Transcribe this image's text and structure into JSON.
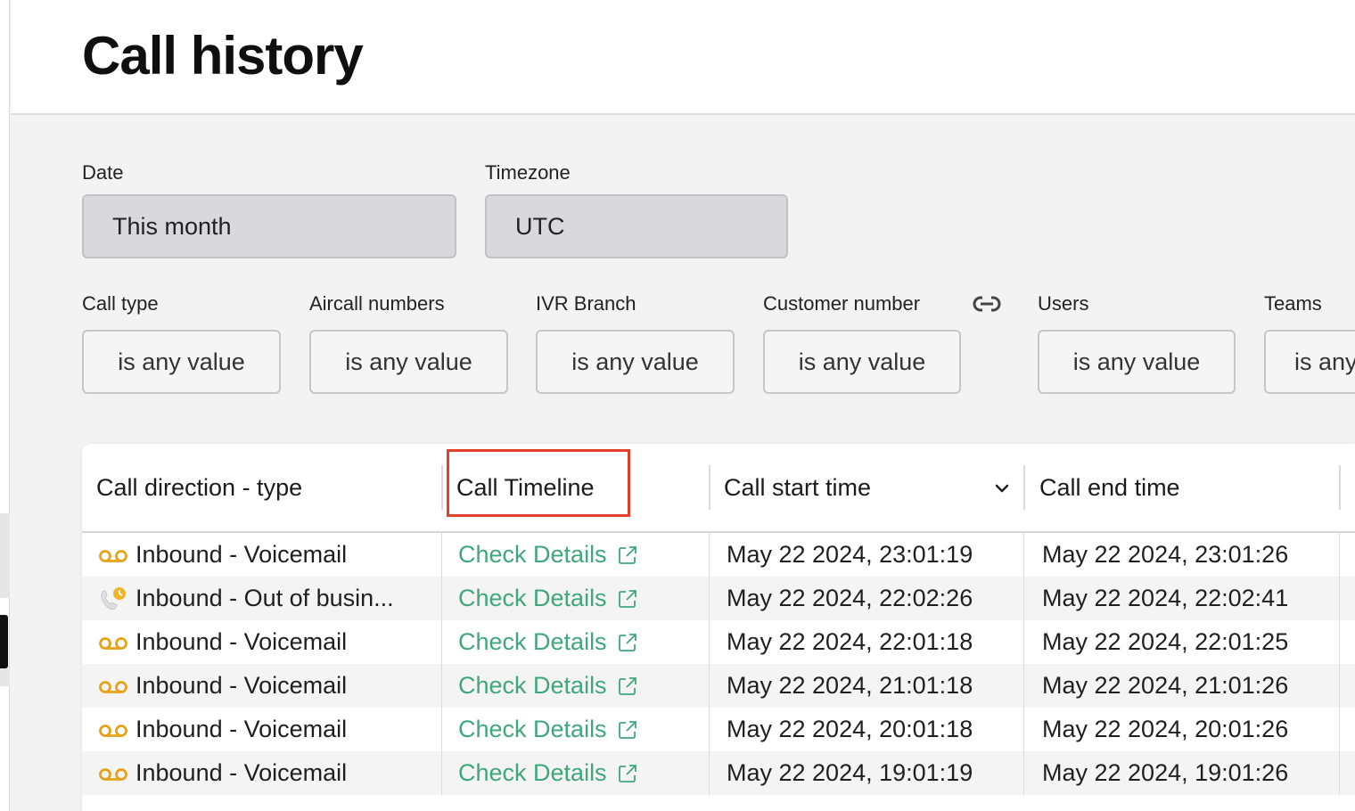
{
  "page": {
    "title": "Call history"
  },
  "filters": {
    "date": {
      "label": "Date",
      "value": "This month"
    },
    "timezone": {
      "label": "Timezone",
      "value": "UTC"
    },
    "items": [
      {
        "label": "Call type",
        "value": "is any value"
      },
      {
        "label": "Aircall numbers",
        "value": "is any value"
      },
      {
        "label": "IVR Branch",
        "value": "is any value"
      },
      {
        "label": "Customer number",
        "value": "is any value"
      },
      {
        "label": "Users",
        "value": "is any value"
      },
      {
        "label": "Teams",
        "value": "is any"
      }
    ]
  },
  "table": {
    "columns": [
      "Call direction - type",
      "Call Timeline",
      "Call start time",
      "Call end time"
    ],
    "rows": [
      {
        "type": "Inbound - Voicemail",
        "icon": "voicemail-icon",
        "timeline": "Check Details",
        "start": "May 22 2024, 23:01:19",
        "end": "May 22 2024, 23:01:26"
      },
      {
        "type": "Inbound - Out of busin...",
        "icon": "out-of-hours-icon",
        "timeline": "Check Details",
        "start": "May 22 2024, 22:02:26",
        "end": "May 22 2024, 22:02:41"
      },
      {
        "type": "Inbound - Voicemail",
        "icon": "voicemail-icon",
        "timeline": "Check Details",
        "start": "May 22 2024, 22:01:18",
        "end": "May 22 2024, 22:01:25"
      },
      {
        "type": "Inbound - Voicemail",
        "icon": "voicemail-icon",
        "timeline": "Check Details",
        "start": "May 22 2024, 21:01:18",
        "end": "May 22 2024, 21:01:26"
      },
      {
        "type": "Inbound - Voicemail",
        "icon": "voicemail-icon",
        "timeline": "Check Details",
        "start": "May 22 2024, 20:01:18",
        "end": "May 22 2024, 20:01:26"
      },
      {
        "type": "Inbound - Voicemail",
        "icon": "voicemail-icon",
        "timeline": "Check Details",
        "start": "May 22 2024, 19:01:19",
        "end": "May 22 2024, 19:01:26"
      }
    ]
  },
  "colors": {
    "accent_link": "#3fa77a",
    "highlight": "#e2402a",
    "voicemail_icon": "#e7a21a"
  }
}
